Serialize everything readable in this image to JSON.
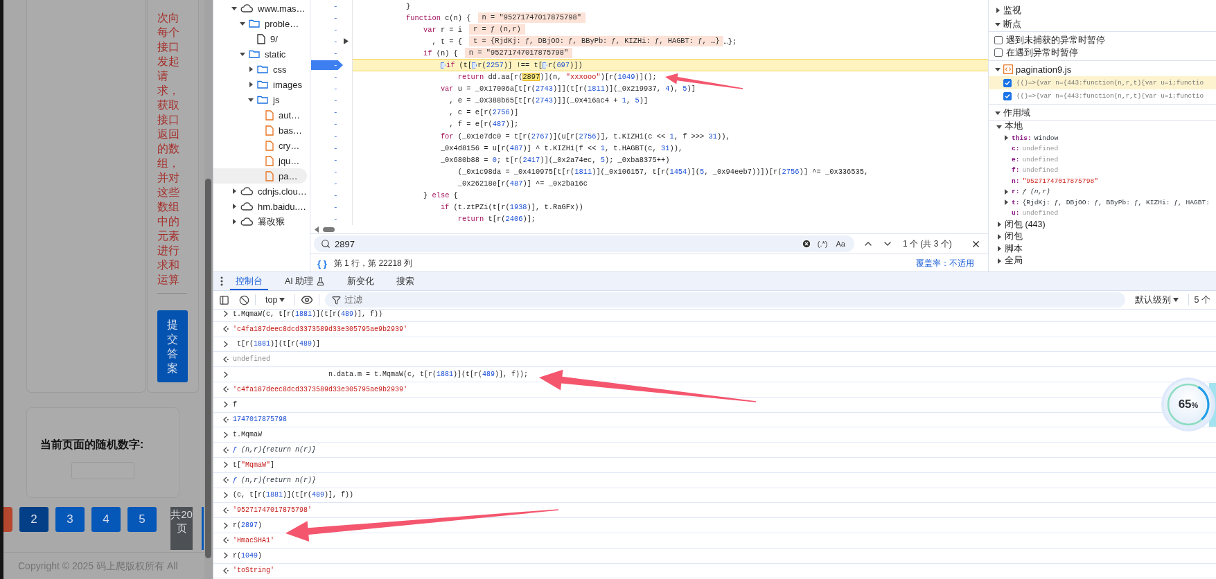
{
  "page": {
    "instructions": "次向每个接口发起请求，获取接口返回的数组，并对这些数组中的元素进行求和运算",
    "submit_button": "提交答案",
    "random_card": {
      "title": "当前页面的随机数字:"
    },
    "pagination": {
      "pages": [
        {
          "label": "2",
          "selected": true
        },
        {
          "label": "3",
          "selected": false
        },
        {
          "label": "4",
          "selected": false
        },
        {
          "label": "5",
          "selected": false
        }
      ],
      "total": "共20页"
    },
    "footer": "Copyright © 2025 码上爬版权所有 All"
  },
  "sources": {
    "tree": [
      {
        "label": "www.mas…",
        "kind": "domain",
        "expanded": true,
        "selected": false,
        "children": [
          {
            "label": "proble…",
            "kind": "folder",
            "expanded": true,
            "selected": false,
            "children": [
              {
                "label": "9/",
                "kind": "page",
                "selected": false
              }
            ]
          },
          {
            "label": "static",
            "kind": "folder",
            "expanded": true,
            "selected": false,
            "children": [
              {
                "label": "css",
                "kind": "folder",
                "expanded": false,
                "selected": false
              },
              {
                "label": "images",
                "kind": "folder",
                "expanded": false,
                "selected": false
              },
              {
                "label": "js",
                "kind": "folder",
                "expanded": true,
                "selected": false,
                "children": [
                  {
                    "label": "aut…",
                    "kind": "script",
                    "selected": false
                  },
                  {
                    "label": "bas…",
                    "kind": "script",
                    "selected": false
                  },
                  {
                    "label": "cry…",
                    "kind": "script",
                    "selected": false
                  },
                  {
                    "label": "jqu…",
                    "kind": "script",
                    "selected": false
                  },
                  {
                    "label": "pa…",
                    "kind": "script",
                    "selected": true
                  }
                ]
              }
            ]
          }
        ]
      },
      {
        "label": "cdnjs.clou…",
        "kind": "domain",
        "expanded": false,
        "selected": false
      },
      {
        "label": "hm.baidu.…",
        "kind": "domain",
        "expanded": false,
        "selected": false
      },
      {
        "label": "篡改猴",
        "kind": "domain",
        "expanded": false,
        "selected": false
      }
    ],
    "code": [
      {
        "number": "-",
        "paused": false,
        "expandable": false,
        "parts": [
          "}"
        ]
      },
      {
        "number": "-",
        "paused": false,
        "expandable": false,
        "parts": [
          {
            "kind": "keyword",
            "text": "function"
          },
          " c(n) {"
        ],
        "inline_value": "n = \"95271747017875798\""
      },
      {
        "number": "-",
        "paused": false,
        "expandable": false,
        "parts": [
          {
            "kind": "keyword",
            "text": "    var"
          },
          " r = i"
        ],
        "inline_value": "r = ƒ (n,r)"
      },
      {
        "number": "-",
        "paused": false,
        "expandable": true,
        "parts": [
          "      , t = {"
        ],
        "inline_value": "t = {RjdKj: ƒ, DBjOO: ƒ, BByPb: ƒ, KIZHi: ƒ, HAGBT: ƒ, …}",
        "trailing": "…};"
      },
      {
        "number": "-",
        "paused": false,
        "expandable": false,
        "parts": [
          {
            "kind": "keyword",
            "text": "    if"
          },
          " (n) {"
        ],
        "inline_value": "n = \"95271747017875798\""
      },
      {
        "number": "-",
        "paused": true,
        "expandable": false,
        "parts": [
          {
            "kind": "keyword",
            "text": "        if",
            "breakpoint": true
          },
          " (t[",
          {
            "kind": "plain",
            "text": "r(",
            "breakpoint": true
          },
          {
            "kind": "number",
            "text": "2257"
          },
          ")] !== t[",
          {
            "kind": "plain",
            "text": "r(",
            "breakpoint": true
          },
          {
            "kind": "number",
            "text": "697"
          },
          ")])"
        ]
      },
      {
        "number": "-",
        "paused": false,
        "expandable": false,
        "parts": [
          {
            "kind": "keyword",
            "text": "            return"
          },
          " dd.aa[r(",
          {
            "kind": "match",
            "text": "2897"
          },
          ")](n, ",
          {
            "kind": "string",
            "text": "\"xxxooo\""
          },
          ")[r(",
          {
            "kind": "number",
            "text": "1049"
          },
          ")]();"
        ]
      },
      {
        "number": "-",
        "paused": false,
        "expandable": false,
        "parts": [
          {
            "kind": "keyword",
            "text": "        var"
          },
          " u = _0x17006a[t[r(",
          {
            "kind": "number",
            "text": "2743"
          },
          ")]](t[r(",
          {
            "kind": "number",
            "text": "1811"
          },
          ")](_0x219937, ",
          {
            "kind": "number",
            "text": "4"
          },
          "), ",
          {
            "kind": "number",
            "text": "5"
          },
          ")]"
        ]
      },
      {
        "number": "-",
        "paused": false,
        "expandable": false,
        "parts": [
          "          , e = _0x388b65[t[r(",
          {
            "kind": "number",
            "text": "2743"
          },
          ")]](_0x416ac4 + ",
          {
            "kind": "number",
            "text": "1"
          },
          ", ",
          {
            "kind": "number",
            "text": "5"
          },
          ")]"
        ]
      },
      {
        "number": "-",
        "paused": false,
        "expandable": false,
        "parts": [
          "          , c = e[r(",
          {
            "kind": "number",
            "text": "2756"
          },
          ")]"
        ]
      },
      {
        "number": "-",
        "paused": false,
        "expandable": false,
        "parts": [
          "          , f = e[r(",
          {
            "kind": "number",
            "text": "487"
          },
          ")];"
        ]
      },
      {
        "number": "-",
        "paused": false,
        "expandable": false,
        "parts": [
          {
            "kind": "keyword",
            "text": "        for"
          },
          " (_0x1e7dc0 = t[r(",
          {
            "kind": "number",
            "text": "2767"
          },
          ")](u[r(",
          {
            "kind": "number",
            "text": "2756"
          },
          ")], t.KIZHi(c << ",
          {
            "kind": "number",
            "text": "1"
          },
          ", f >>> ",
          {
            "kind": "number",
            "text": "31"
          },
          ")),"
        ]
      },
      {
        "number": "-",
        "paused": false,
        "expandable": false,
        "parts": [
          "        _0x4d8156 = u[r(",
          {
            "kind": "number",
            "text": "487"
          },
          ")] ^ t.KIZHi(f << ",
          {
            "kind": "number",
            "text": "1"
          },
          ", t.HAGBT(c, ",
          {
            "kind": "number",
            "text": "31"
          },
          ")),"
        ]
      },
      {
        "number": "-",
        "paused": false,
        "expandable": false,
        "parts": [
          "        _0x680b88 = ",
          {
            "kind": "number",
            "text": "0"
          },
          "; t[r(",
          {
            "kind": "number",
            "text": "2417"
          },
          ")](_0x2a74ec, ",
          {
            "kind": "number",
            "text": "5"
          },
          "); _0xba8375++)"
        ]
      },
      {
        "number": "-",
        "paused": false,
        "expandable": false,
        "parts": [
          "            (_0x1c98da = _0x410975[t[r(",
          {
            "kind": "number",
            "text": "1811"
          },
          ")](_0x106157, t[r(",
          {
            "kind": "number",
            "text": "1454"
          },
          ")](",
          {
            "kind": "number",
            "text": "5"
          },
          ", _0x94eeb7))])[r(",
          {
            "kind": "number",
            "text": "2756"
          },
          ")] ^= _0x336535,"
        ]
      },
      {
        "number": "-",
        "paused": false,
        "expandable": false,
        "parts": [
          "            _0x26218e[r(",
          {
            "kind": "number",
            "text": "487"
          },
          ")] ^= _0x2ba16c"
        ]
      },
      {
        "number": "-",
        "paused": false,
        "expandable": false,
        "parts": [
          "    } ",
          {
            "kind": "keyword",
            "text": "else"
          },
          " {"
        ]
      },
      {
        "number": "-",
        "paused": false,
        "expandable": false,
        "parts": [
          {
            "kind": "keyword",
            "text": "        if"
          },
          " (t.ztPZi(t[r(",
          {
            "kind": "number",
            "text": "1938"
          },
          ")], t.RaGFx))"
        ]
      },
      {
        "number": "-",
        "paused": false,
        "expandable": false,
        "parts": [
          {
            "kind": "keyword",
            "text": "            return"
          },
          " t[r(",
          {
            "kind": "number",
            "text": "2406"
          },
          ")];"
        ]
      }
    ],
    "search": {
      "value": "2897",
      "regex": "(.*)",
      "case": "Aa",
      "count": "1 个 (共 3 个)"
    },
    "status": {
      "pretty_print": "{ }",
      "position": "第 1 行，第 22218 列",
      "coverage": "覆盖率：不适用"
    }
  },
  "debugger": {
    "watch": {
      "label": "监视",
      "expanded": false
    },
    "breakpoints": {
      "label": "断点",
      "expanded": true,
      "options": [
        {
          "label": "遇到未捕获的异常时暂停",
          "checked": false
        },
        {
          "label": "在遇到异常时暂停",
          "checked": false
        }
      ],
      "file": {
        "name": "pagination9.js",
        "expanded": true
      },
      "items": [
        {
          "code": "(()=>{var n={443:function(n,r,t){var u=i;functio",
          "checked": true,
          "selected": true
        },
        {
          "code": "(()=>{var n={443:function(n,r,t){var u=i;functio",
          "checked": true,
          "selected": false
        }
      ]
    },
    "scope": {
      "label": "作用域",
      "expanded": true,
      "groups": [
        {
          "label": "本地",
          "expanded": true,
          "vars": [
            {
              "name": "this:",
              "value": "Window",
              "kind": "object",
              "expanded": false
            },
            {
              "name": "c:",
              "value": "undefined",
              "kind": "undefined"
            },
            {
              "name": "e:",
              "value": "undefined",
              "kind": "undefined"
            },
            {
              "name": "f:",
              "value": "undefined",
              "kind": "undefined"
            },
            {
              "name": "n:",
              "value": "\"95271747017875798\"",
              "kind": "string"
            },
            {
              "name": "r:",
              "value": "ƒ (n,r)",
              "kind": "function",
              "expanded": false
            },
            {
              "name": "t:",
              "value": "{RjdKj: ƒ, DBjOO: ƒ, BByPb: ƒ, KIZHi: ƒ, HAGBT:",
              "kind": "object",
              "expanded": false
            },
            {
              "name": "u:",
              "value": "undefined",
              "kind": "undefined"
            }
          ]
        },
        {
          "label": "闭包 (443)",
          "expanded": false
        },
        {
          "label": "闭包",
          "expanded": false
        },
        {
          "label": "脚本",
          "expanded": false
        },
        {
          "label": "全局",
          "expanded": false
        }
      ]
    }
  },
  "console": {
    "tabs": [
      {
        "label": "控制台",
        "selected": true,
        "kind": "plain"
      },
      {
        "label": "AI 助理",
        "selected": false,
        "kind": "experimental"
      },
      {
        "label": "新变化",
        "selected": false,
        "kind": "plain"
      },
      {
        "label": "搜索",
        "selected": false,
        "kind": "plain"
      }
    ],
    "toolbar": {
      "context": "top",
      "filter_placeholder": "过滤",
      "log_levels": "默认级别",
      "issues": "5 个"
    },
    "rows": [
      {
        "kind": "input",
        "parts": [
          "t.MqmaW(c, t[r(",
          {
            "kind": "number",
            "text": "1881"
          },
          ")](t[r(",
          {
            "kind": "number",
            "text": "489"
          },
          ")], f))"
        ]
      },
      {
        "kind": "string",
        "parts": [
          "'c4fa187deec8dcd3373589d33e305795ae9b2939'"
        ]
      },
      {
        "kind": "input",
        "parts": [
          " t[r(",
          {
            "kind": "number",
            "text": "1881"
          },
          ")](t[r(",
          {
            "kind": "number",
            "text": "489"
          },
          ")]"
        ]
      },
      {
        "kind": "undefined",
        "parts": [
          "undefined"
        ]
      },
      {
        "kind": "input",
        "parts": [
          "                       n.data.m = t.MqmaW(c, t[r(",
          {
            "kind": "number",
            "text": "1881"
          },
          ")](t[r(",
          {
            "kind": "number",
            "text": "489"
          },
          ")], f));"
        ]
      },
      {
        "kind": "string",
        "parts": [
          "'c4fa187deec8dcd3373589d33e305795ae9b2939'"
        ]
      },
      {
        "kind": "input",
        "parts": [
          "f"
        ]
      },
      {
        "kind": "number",
        "parts": [
          "1747017875798"
        ]
      },
      {
        "kind": "input",
        "parts": [
          "t.MqmaW"
        ]
      },
      {
        "kind": "function",
        "parts": [
          {
            "kind": "function",
            "text": "ƒ"
          },
          " (n,r){return n(r)}"
        ]
      },
      {
        "kind": "input",
        "parts": [
          "t[",
          {
            "kind": "string",
            "text": "\"MqmaW\""
          },
          "]"
        ]
      },
      {
        "kind": "function",
        "parts": [
          {
            "kind": "function",
            "text": "ƒ"
          },
          " (n,r){return n(r)}"
        ]
      },
      {
        "kind": "input",
        "parts": [
          "(c, t[r(",
          {
            "kind": "number",
            "text": "1881"
          },
          ")](t[r(",
          {
            "kind": "number",
            "text": "489"
          },
          ")], f))"
        ]
      },
      {
        "kind": "string",
        "parts": [
          "'95271747017875798'"
        ]
      },
      {
        "kind": "input",
        "parts": [
          "r(",
          {
            "kind": "number",
            "text": "2897"
          },
          ")"
        ]
      },
      {
        "kind": "string",
        "parts": [
          "'HmacSHA1'"
        ]
      },
      {
        "kind": "input",
        "parts": [
          "r(",
          {
            "kind": "number",
            "text": "1049"
          },
          ")"
        ]
      },
      {
        "kind": "string",
        "parts": [
          "'toString'"
        ]
      }
    ]
  },
  "badge": {
    "value": "65",
    "unit": "%"
  }
}
